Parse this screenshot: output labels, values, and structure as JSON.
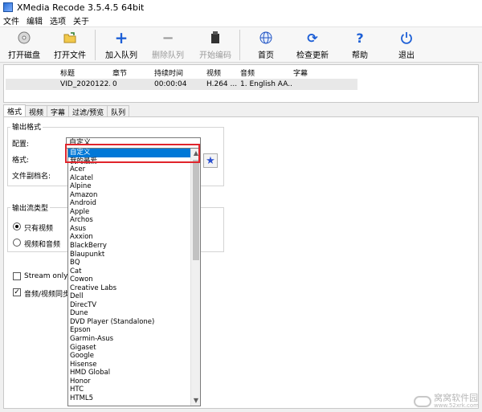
{
  "window": {
    "title": "XMedia Recode 3.5.4.5 64bit"
  },
  "menu": [
    "文件",
    "编辑",
    "选项",
    "关于"
  ],
  "toolbar": [
    {
      "label": "打开磁盘",
      "icon": "disc-icon",
      "enabled": true
    },
    {
      "label": "打开文件",
      "icon": "open-file-icon",
      "enabled": true
    },
    {
      "label": "加入队列",
      "icon": "plus-icon",
      "enabled": true
    },
    {
      "label": "删除队列",
      "icon": "minus-icon",
      "enabled": false
    },
    {
      "label": "开始编码",
      "icon": "encode-icon",
      "enabled": false
    },
    {
      "label": "首页",
      "icon": "globe-icon",
      "enabled": true
    },
    {
      "label": "检查更新",
      "icon": "refresh-icon",
      "enabled": true
    },
    {
      "label": "帮助",
      "icon": "question-icon",
      "enabled": true
    },
    {
      "label": "退出",
      "icon": "power-icon",
      "enabled": true
    }
  ],
  "filelist": {
    "headers": [
      "标题",
      "章节",
      "持续时间",
      "视频",
      "音频",
      "字幕"
    ],
    "rows": [
      [
        "VID_2020122...",
        "0",
        "00:00:04",
        "H.264 ...",
        "1. English AA...",
        ""
      ]
    ]
  },
  "tabs": [
    "格式",
    "视频",
    "字幕",
    "过滤/预览",
    "队列"
  ],
  "output_format": {
    "group_label": "输出格式",
    "profile_label": "配置:",
    "profile_value": "自定义",
    "format_label": "格式:",
    "suffix_label": "文件副档名:"
  },
  "stream_type": {
    "group_label": "输出流类型",
    "options": [
      {
        "label": "只有视频",
        "selected": true
      },
      {
        "label": "视频和音频",
        "selected": false
      }
    ]
  },
  "checkboxes": [
    {
      "label": "Stream only co",
      "checked": false
    },
    {
      "label": "音频/视频同步",
      "checked": true
    }
  ],
  "dropdown": {
    "selected_index": 0,
    "items": [
      "自定义",
      "我的最爱",
      "Acer",
      "Alcatel",
      "Alpine",
      "Amazon",
      "Android",
      "Apple",
      "Archos",
      "Asus",
      "Axxion",
      "BlackBerry",
      "Blaupunkt",
      "BQ",
      "Cat",
      "Cowon",
      "Creative Labs",
      "Dell",
      "DirecTV",
      "Dune",
      "DVD Player (Standalone)",
      "Epson",
      "Garmin-Asus",
      "Gigaset",
      "Google",
      "Hisense",
      "HMD Global",
      "Honor",
      "HTC",
      "HTML5"
    ]
  },
  "watermark": {
    "text": "窝窝软件园",
    "sub": "www.52xrk.com"
  },
  "colors": {
    "selection": "#0078d7",
    "highlight_box": "#e0242b"
  }
}
